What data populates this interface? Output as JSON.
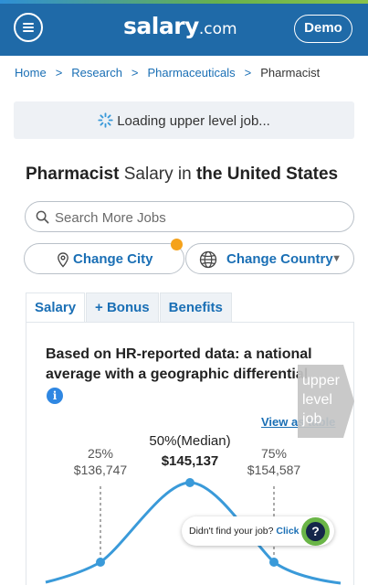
{
  "header": {
    "logo_main": "salary",
    "logo_suffix": ".com",
    "demo_label": "Demo"
  },
  "breadcrumb": {
    "items": [
      "Home",
      "Research",
      "Pharmaceuticals"
    ],
    "separator": ">",
    "current": "Pharmacist"
  },
  "loading": {
    "text": "Loading upper level job..."
  },
  "heading": {
    "job": "Pharmacist",
    "mid": " Salary in ",
    "location": "the United States"
  },
  "search": {
    "placeholder": "Search More Jobs"
  },
  "location_buttons": {
    "city_label": "Change City",
    "country_label": "Change Country"
  },
  "tabs": [
    "Salary",
    "+ Bonus",
    "Benefits"
  ],
  "card": {
    "title": "Based on HR-reported data: a national average with a geographic differential",
    "info_icon": "i",
    "view_as_table": "View as table",
    "upper_tag": "upper level job"
  },
  "percentiles": {
    "p25": {
      "label": "25%",
      "value": "$136,747"
    },
    "p50": {
      "label": "50%(Median)",
      "value": "$145,137"
    },
    "p75": {
      "label": "75%",
      "value": "$154,587"
    }
  },
  "help": {
    "prompt": "Didn't find your job?",
    "link": "Click",
    "icon": "?"
  },
  "colors": {
    "header_bg": "#1f6aa8",
    "link": "#1a6fb5",
    "curve": "#3a9ad9",
    "notification": "#f5a21b",
    "help_green": "#6ab547"
  }
}
